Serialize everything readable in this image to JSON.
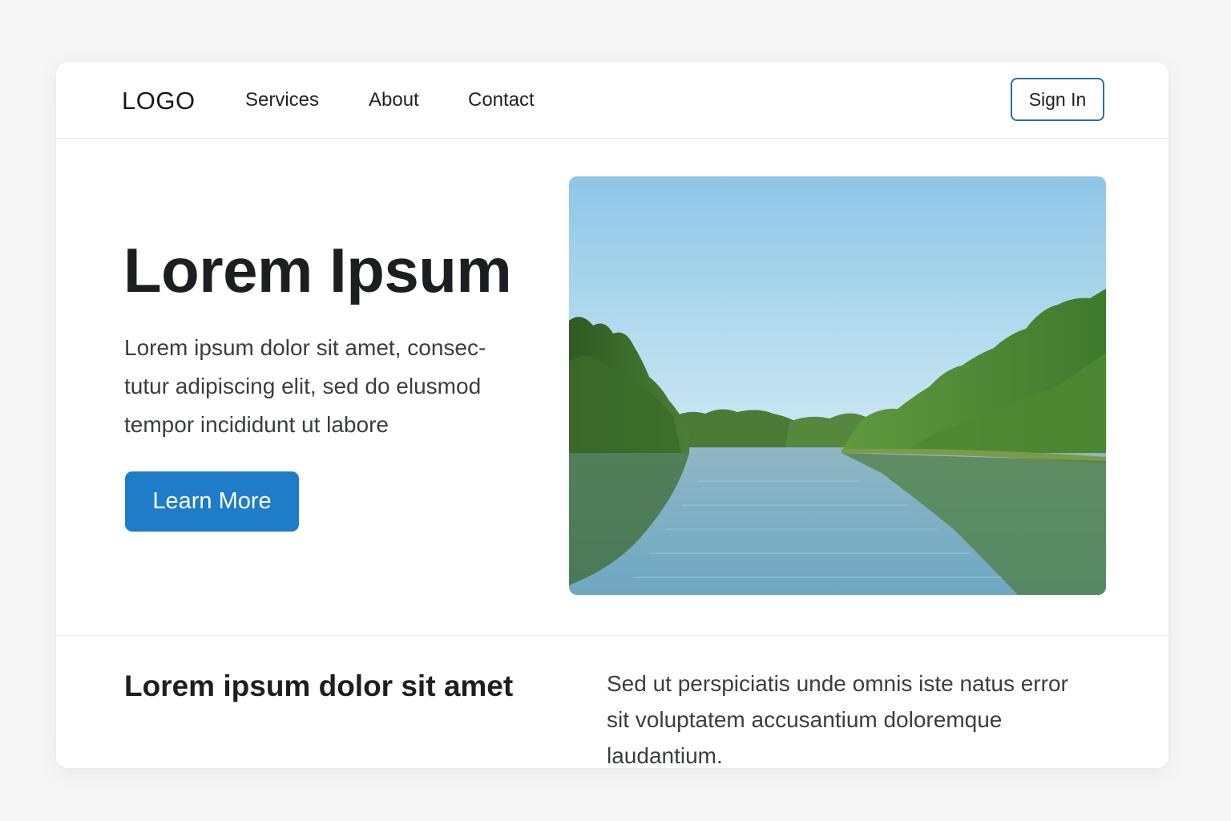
{
  "nav": {
    "logo": "LOGO",
    "links": [
      {
        "label": "Services"
      },
      {
        "label": "About"
      },
      {
        "label": "Contact"
      }
    ],
    "sign_in_label": "Sign In"
  },
  "hero": {
    "title": "Lorem Ipsum",
    "paragraph_lines": [
      "Lorem ipsum dolor sit amet, consec-",
      "tutur adipiscing elit, sed do elusmod",
      "tempor incididunt ut labore"
    ],
    "cta_label": "Learn More",
    "image_icon": "lake-landscape-image"
  },
  "feature": {
    "title": "Lorem ipsum dolor sit amet",
    "paragraph_lines": [
      "Sed ut perspiciatis unde omnis iste natus error",
      "sit voluptatem accusantium doloremque",
      "laudantium."
    ]
  },
  "colors": {
    "accent": "#1f7cc8",
    "sign_in_border": "#2a6fa8",
    "page_background": "#f6f6f6",
    "text": "#1d1f22"
  }
}
